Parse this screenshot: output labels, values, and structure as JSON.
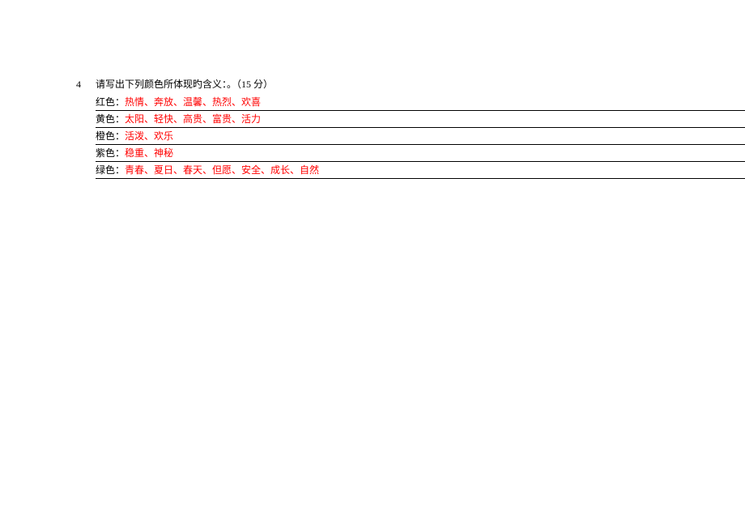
{
  "question": {
    "number": "4",
    "prompt": "请写出下列颜色所体现旳含义：。（15 分）",
    "items": [
      {
        "label": "红色：",
        "answer": "热情、奔放、温馨、热烈、欢喜"
      },
      {
        "label": "黄色：",
        "answer": "太阳、轻快、高贵、富贵、活力"
      },
      {
        "label": "橙色：",
        "answer": "活泼、欢乐"
      },
      {
        "label": "紫色：",
        "answer": "稳重、神秘"
      },
      {
        "label": "绿色：",
        "answer": "青春、夏日、春天、但愿、安全、成长、自然"
      }
    ]
  }
}
